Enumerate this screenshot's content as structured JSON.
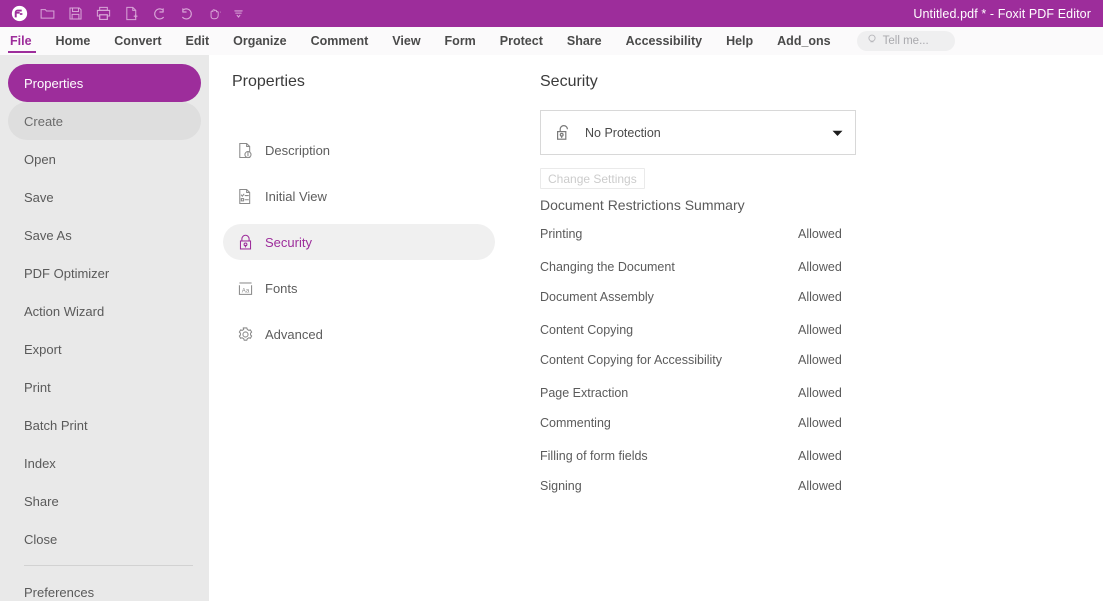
{
  "titlebar": {
    "document_title": "Untitled.pdf * - Foxit PDF Editor",
    "quick_access": [
      {
        "name": "foxit-logo-icon",
        "label": "Foxit"
      },
      {
        "name": "open-folder-icon",
        "label": "Open"
      },
      {
        "name": "save-icon",
        "label": "Save"
      },
      {
        "name": "print-icon",
        "label": "Print"
      },
      {
        "name": "create-pdf-icon",
        "label": "Create PDF"
      },
      {
        "name": "undo-icon",
        "label": "Undo"
      },
      {
        "name": "redo-icon",
        "label": "Redo"
      },
      {
        "name": "hand-tool-icon",
        "label": "Hand Tool"
      }
    ],
    "customize_caret": "customize-quick-access-icon",
    "accent_color": "#9d2d9b"
  },
  "menubar": {
    "items": [
      {
        "label": "File",
        "active": true
      },
      {
        "label": "Home",
        "active": false
      },
      {
        "label": "Convert",
        "active": false
      },
      {
        "label": "Edit",
        "active": false
      },
      {
        "label": "Organize",
        "active": false
      },
      {
        "label": "Comment",
        "active": false
      },
      {
        "label": "View",
        "active": false
      },
      {
        "label": "Form",
        "active": false
      },
      {
        "label": "Protect",
        "active": false
      },
      {
        "label": "Share",
        "active": false
      },
      {
        "label": "Accessibility",
        "active": false
      },
      {
        "label": "Help",
        "active": false
      },
      {
        "label": "Add_ons",
        "active": false
      }
    ],
    "tell_me": {
      "placeholder": "Tell me...",
      "icon": "lightbulb-icon"
    }
  },
  "sidebar": {
    "items": [
      {
        "label": "Properties",
        "state": "selected"
      },
      {
        "label": "Create",
        "state": "hover"
      },
      {
        "label": "Open",
        "state": "normal"
      },
      {
        "label": "Save",
        "state": "normal"
      },
      {
        "label": "Save As",
        "state": "normal"
      },
      {
        "label": "PDF Optimizer",
        "state": "normal"
      },
      {
        "label": "Action Wizard",
        "state": "normal"
      },
      {
        "label": "Export",
        "state": "normal"
      },
      {
        "label": "Print",
        "state": "normal"
      },
      {
        "label": "Batch Print",
        "state": "normal"
      },
      {
        "label": "Index",
        "state": "normal"
      },
      {
        "label": "Share",
        "state": "normal"
      },
      {
        "label": "Close",
        "state": "normal"
      }
    ],
    "footer_items": [
      {
        "label": "Preferences",
        "state": "normal"
      }
    ]
  },
  "properties_panel": {
    "title": "Properties",
    "items": [
      {
        "label": "Description",
        "icon": "document-info-icon",
        "state": "normal"
      },
      {
        "label": "Initial View",
        "icon": "document-list-icon",
        "state": "normal"
      },
      {
        "label": "Security",
        "icon": "lock-icon",
        "state": "selected"
      },
      {
        "label": "Fonts",
        "icon": "font-aa-icon",
        "state": "normal"
      },
      {
        "label": "Advanced",
        "icon": "gear-icon",
        "state": "normal"
      }
    ]
  },
  "security_panel": {
    "title": "Security",
    "protection_select": {
      "value": "No Protection",
      "icon": "unlocked-padlock-icon",
      "caret": "chevron-down-icon",
      "options": [
        "No Protection"
      ]
    },
    "change_settings_label": "Change Settings",
    "change_settings_enabled": false,
    "restrictions_title": "Document Restrictions Summary",
    "restrictions": [
      {
        "name": "Printing",
        "value": "Allowed"
      },
      {
        "name": "Changing the Document",
        "value": "Allowed"
      },
      {
        "name": "Document Assembly",
        "value": "Allowed"
      },
      {
        "name": "Content Copying",
        "value": "Allowed"
      },
      {
        "name": "Content Copying for Accessibility",
        "value": "Allowed"
      },
      {
        "name": "Page Extraction",
        "value": "Allowed"
      },
      {
        "name": "Commenting",
        "value": "Allowed"
      },
      {
        "name": "Filling of form fields",
        "value": "Allowed"
      },
      {
        "name": "Signing",
        "value": "Allowed"
      }
    ]
  }
}
